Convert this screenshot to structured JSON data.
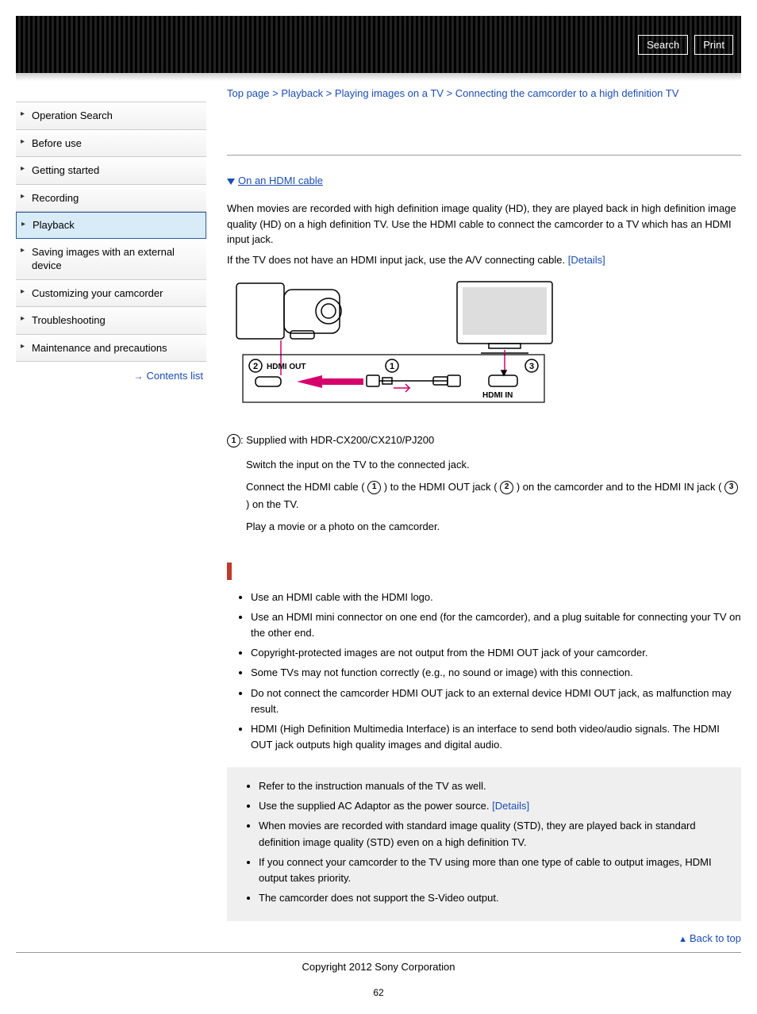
{
  "banner": {
    "search": "Search",
    "print": "Print"
  },
  "sidebar": {
    "items": [
      "Operation Search",
      "Before use",
      "Getting started",
      "Recording",
      "Playback",
      "Saving images with an external device",
      "Customizing your camcorder",
      "Troubleshooting",
      "Maintenance and precautions"
    ],
    "active_index": 4,
    "contents_list": "Contents list"
  },
  "breadcrumb": {
    "parts": [
      "Top page",
      "Playback",
      "Playing images on a TV",
      "Connecting the camcorder to a high definition TV"
    ],
    "sep": " > "
  },
  "toc": {
    "hdmi": "On an HDMI cable"
  },
  "intro": {
    "p1": "When movies are recorded with high definition image quality (HD), they are played back in high definition image quality (HD) on a high definition TV. Use the HDMI cable to connect the camcorder to a TV which has an HDMI input jack.",
    "p2_pre": "If the TV does not have an HDMI input jack, use the A/V connecting cable. ",
    "details": "[Details]"
  },
  "diagram": {
    "hdmi_out": "HDMI OUT",
    "hdmi_in": "HDMI IN"
  },
  "steps": {
    "supplied": ": Supplied with HDR-CX200/CX210/PJ200",
    "s1": "Switch the input on the TV to the connected jack.",
    "s2a": "Connect the HDMI cable ( ",
    "s2b": " ) to the HDMI OUT jack ( ",
    "s2c": " ) on the camcorder and to the HDMI IN jack ( ",
    "s2d": " ) on the TV.",
    "s3": "Play a movie or a photo on the camcorder."
  },
  "notes": [
    "Use an HDMI cable with the HDMI logo.",
    "Use an HDMI mini connector on one end (for the camcorder), and a plug suitable for connecting your TV on the other end.",
    "Copyright-protected images are not output from the HDMI OUT jack of your camcorder.",
    "Some TVs may not function correctly (e.g., no sound or image) with this connection.",
    "Do not connect the camcorder HDMI OUT jack to an external device HDMI OUT jack, as malfunction may result.",
    "HDMI (High Definition Multimedia Interface) is an interface to send both video/audio signals. The HDMI OUT jack outputs high quality images and digital audio."
  ],
  "graybox": {
    "items": [
      {
        "text": "Refer to the instruction manuals of the TV as well."
      },
      {
        "text_pre": "Use the supplied AC Adaptor as the power source. ",
        "link": "[Details]"
      },
      {
        "text": "When movies are recorded with standard image quality (STD), they are played back in standard definition image quality (STD) even on a high definition TV."
      },
      {
        "text": "If you connect your camcorder to the TV using more than one type of cable to output images, HDMI output takes priority."
      },
      {
        "text": "The camcorder does not support the S-Video output."
      }
    ]
  },
  "backtop": "Back to top",
  "copyright": "Copyright 2012 Sony Corporation",
  "page_number": "62"
}
